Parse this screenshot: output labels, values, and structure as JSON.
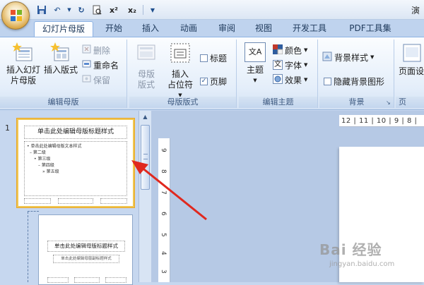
{
  "titlebar": {
    "title": "演"
  },
  "qat": {
    "icons": [
      "save-icon",
      "undo-icon",
      "redo-icon",
      "print-preview-icon",
      "superscript-icon",
      "subscript-icon",
      "customize-icon"
    ],
    "superscript": "x²",
    "subscript": "x₂"
  },
  "tabs": [
    "幻灯片母版",
    "开始",
    "插入",
    "动画",
    "审阅",
    "视图",
    "开发工具",
    "PDF工具集"
  ],
  "active_tab": "幻灯片母版",
  "ribbon": {
    "edit_master": {
      "label": "编辑母版",
      "insert_slide_master": "插入幻灯片母版",
      "insert_slide_master_l1": "插入幻灯",
      "insert_slide_master_l2": "片母版",
      "insert_layout": "插入版式",
      "delete": "删除",
      "rename": "重命名",
      "preserve": "保留"
    },
    "master_layout": {
      "label": "母版版式",
      "master_layout_btn_l1": "母版",
      "master_layout_btn_l2": "版式",
      "insert_placeholder_l1": "插入",
      "insert_placeholder_l2": "占位符",
      "title": "标题",
      "title_checked": false,
      "footer": "页脚",
      "footer_checked": true
    },
    "edit_theme": {
      "label": "编辑主题",
      "theme": "主题",
      "theme_icon_text": "文A",
      "colors": "颜色",
      "fonts": "字体",
      "effects": "效果",
      "font_icon_text": "文"
    },
    "background": {
      "label": "背景",
      "background_styles": "背景样式",
      "hide_bg_graphics": "隐藏背景图形",
      "hide_checked": false
    },
    "page_setup": {
      "label": "页",
      "page_setup_btn": "页面设"
    }
  },
  "thumbnails": {
    "slide_number": "1",
    "master": {
      "title": "单击此处编辑母版标题样式",
      "body_lines": [
        "• 单击此处编辑母版文本样式",
        "  – 第二级",
        "    • 第三级",
        "      – 第四级",
        "        » 第五级"
      ]
    },
    "layout": {
      "title": "单击此处编辑母版标题样式",
      "subtitle": "单击此处编辑母版副标题样式"
    }
  },
  "ruler": {
    "horizontal": "12 | 11 | 10 | 9 | 8 |",
    "vertical_marks": [
      "9",
      "8",
      "7",
      "6",
      "5",
      "4",
      "3"
    ]
  },
  "watermark": {
    "main": "Bai 经验",
    "sub": "jingyan.baidu.com"
  },
  "colors": {
    "office_button": "#d9a441",
    "active_tab_border": "#8db2e3",
    "thumb_selection": "#f0c650",
    "arrow": "#e0281e"
  }
}
